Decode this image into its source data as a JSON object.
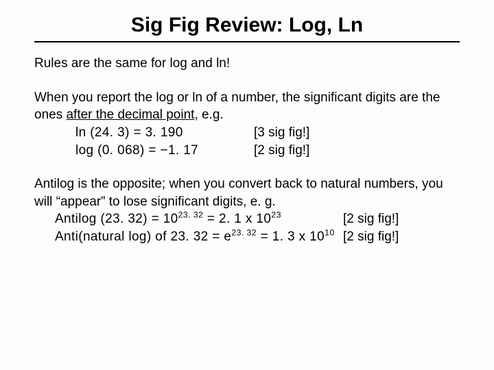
{
  "title": "Sig Fig Review: Log, Ln",
  "intro": "Rules are the same for log and ln!",
  "p2_line1_a": "When you report the log or ln of a number, the significant digits are the ones ",
  "p2_line1_u": "after the decimal point",
  "p2_line1_b": ", e.g.",
  "ex1_eq": "ln (24. 3) = 3. 190",
  "ex1_note": "[3 sig fig!]",
  "ex2_eq": "log (0. 068) = −1. 17",
  "ex2_note": "[2 sig fig!]",
  "p3_text": "Antilog is the opposite; when you convert back to natural numbers, you will “appear” to lose significant digits, e. g.",
  "ex3_a": "Antilog (23. 32) = 10",
  "ex3_sup1": "23. 32",
  "ex3_b": " = 2. 1 x 10",
  "ex3_sup2": "23",
  "ex3_note": "[2 sig fig!]",
  "ex4_a": "Anti(natural log) of 23. 32 = e",
  "ex4_sup1": "23. 32",
  "ex4_b": " = 1. 3 x 10",
  "ex4_sup2": "10",
  "ex4_note": "[2 sig fig!]"
}
